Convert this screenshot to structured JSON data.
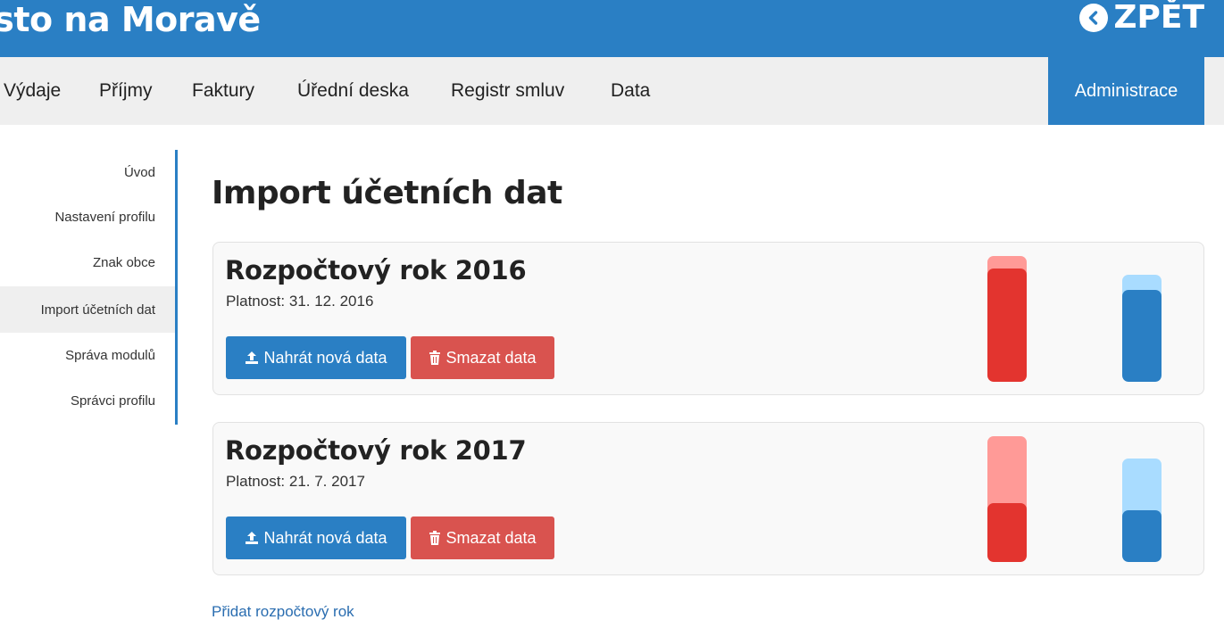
{
  "header": {
    "site_title": "ěsto na Moravě",
    "back_label": "ZPĚT"
  },
  "nav": {
    "items": [
      {
        "label": "Výdaje"
      },
      {
        "label": "Příjmy"
      },
      {
        "label": "Faktury"
      },
      {
        "label": "Úřední deska"
      },
      {
        "label": "Registr smluv"
      },
      {
        "label": "Data"
      }
    ],
    "admin_label": "Administrace"
  },
  "sidebar": {
    "items": [
      {
        "label": "Úvod"
      },
      {
        "label": "Nastavení profilu"
      },
      {
        "label": "Znak obce"
      },
      {
        "label": "Import účetních dat",
        "active": true
      },
      {
        "label": "Správa modulů"
      },
      {
        "label": "Správci profilu"
      }
    ]
  },
  "main": {
    "title": "Import účetních dat",
    "years": [
      {
        "title": "Rozpočtový rok 2016",
        "validity": "Platnost: 31. 12. 2016",
        "upload_label": "Nahrát nová data",
        "delete_label": "Smazat data",
        "expense_fill": 0.9,
        "income_fill": 0.86
      },
      {
        "title": "Rozpočtový rok 2017",
        "validity": "Platnost: 21. 7. 2017",
        "upload_label": "Nahrát nová data",
        "delete_label": "Smazat data",
        "expense_fill": 0.47,
        "income_fill": 0.5
      }
    ],
    "add_year_label": "Přidat rozpočtový rok"
  },
  "colors": {
    "primary": "#2a7fc4",
    "danger": "#d9534f",
    "bar_red": "#e3342f",
    "bar_red_light": "#ff9a97",
    "bar_blue": "#2a7fc4",
    "bar_blue_light": "#a9dcff"
  },
  "icons": {
    "back": "chevron-left-circle-icon",
    "upload": "upload-icon",
    "delete": "trash-icon"
  }
}
